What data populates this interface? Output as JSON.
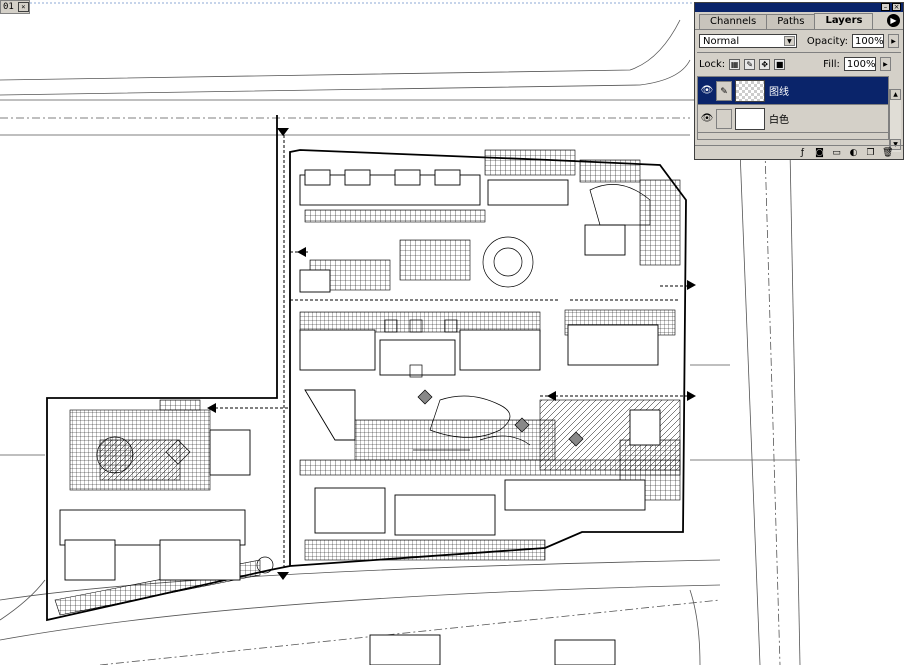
{
  "document": {
    "tab_label": "01",
    "close_glyph": "×"
  },
  "layers_panel": {
    "tabs": [
      {
        "label": "Channels",
        "active": false
      },
      {
        "label": "Paths",
        "active": false
      },
      {
        "label": "Layers",
        "active": true
      }
    ],
    "blend_mode": "Normal",
    "opacity_label": "Opacity:",
    "opacity_value": "100%",
    "lock_label": "Lock:",
    "fill_label": "Fill:",
    "fill_value": "100%",
    "layers": [
      {
        "name": "图线",
        "selected": true,
        "visible": true
      },
      {
        "name": "白色",
        "selected": false,
        "visible": true
      }
    ],
    "bottom_icons": [
      "link-layers-icon",
      "layer-style-icon",
      "layer-mask-icon",
      "new-group-icon",
      "adjustment-layer-icon",
      "new-layer-icon",
      "trash-icon"
    ]
  },
  "colors": {
    "palette_bg": "#d4d0c8",
    "title_blue": "#0a246a",
    "selected_blue": "#0a246a"
  }
}
